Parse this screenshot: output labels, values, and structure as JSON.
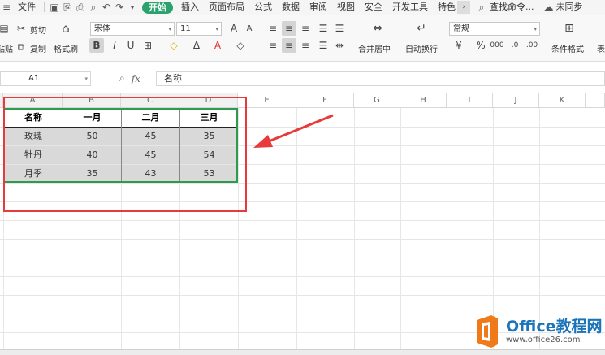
{
  "menubar": {
    "file": "文件",
    "active_tab": "开始",
    "tabs": [
      "插入",
      "页面布局",
      "公式",
      "数据",
      "审阅",
      "视图",
      "安全",
      "开发工具",
      "特色"
    ],
    "search": "查找命令...",
    "sync": "未同步"
  },
  "ribbon": {
    "cut": "剪切",
    "paste": "粘贴",
    "copy": "复制",
    "format_painter": "格式刷",
    "font_name": "宋体",
    "font_size": "11",
    "merge_center": "合并居中",
    "wrap_text": "自动换行",
    "number_format": "常规",
    "conditional_format": "条件格式",
    "table_style": "表"
  },
  "formula_bar": {
    "cell_ref": "A1",
    "fx": "fx",
    "content": "名称"
  },
  "columns": [
    "A",
    "B",
    "C",
    "D",
    "E",
    "F",
    "G",
    "H",
    "I",
    "J",
    "K"
  ],
  "table": {
    "headers": [
      "名称",
      "一月",
      "二月",
      "三月"
    ],
    "rows": [
      [
        "玫瑰",
        "50",
        "45",
        "35"
      ],
      [
        "牡丹",
        "40",
        "45",
        "54"
      ],
      [
        "月季",
        "35",
        "43",
        "53"
      ]
    ]
  },
  "watermark": {
    "title": "Office教程网",
    "url": "www.office26.com"
  },
  "colors": {
    "accent_green": "#2aa26c",
    "selection_green": "#2e9b4c",
    "highlight_red": "#e83a3a",
    "watermark_orange": "#f07a1a",
    "watermark_blue": "#1b73b8"
  }
}
